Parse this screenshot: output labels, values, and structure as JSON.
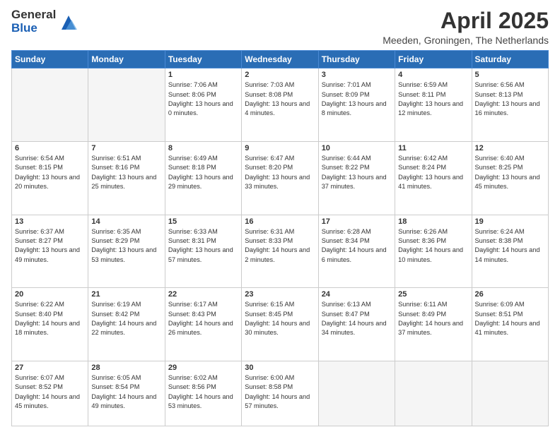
{
  "header": {
    "logo_general": "General",
    "logo_blue": "Blue",
    "month_title": "April 2025",
    "location": "Meeden, Groningen, The Netherlands"
  },
  "days_of_week": [
    "Sunday",
    "Monday",
    "Tuesday",
    "Wednesday",
    "Thursday",
    "Friday",
    "Saturday"
  ],
  "weeks": [
    [
      {
        "day": "",
        "info": ""
      },
      {
        "day": "",
        "info": ""
      },
      {
        "day": "1",
        "info": "Sunrise: 7:06 AM\nSunset: 8:06 PM\nDaylight: 13 hours and 0 minutes."
      },
      {
        "day": "2",
        "info": "Sunrise: 7:03 AM\nSunset: 8:08 PM\nDaylight: 13 hours and 4 minutes."
      },
      {
        "day": "3",
        "info": "Sunrise: 7:01 AM\nSunset: 8:09 PM\nDaylight: 13 hours and 8 minutes."
      },
      {
        "day": "4",
        "info": "Sunrise: 6:59 AM\nSunset: 8:11 PM\nDaylight: 13 hours and 12 minutes."
      },
      {
        "day": "5",
        "info": "Sunrise: 6:56 AM\nSunset: 8:13 PM\nDaylight: 13 hours and 16 minutes."
      }
    ],
    [
      {
        "day": "6",
        "info": "Sunrise: 6:54 AM\nSunset: 8:15 PM\nDaylight: 13 hours and 20 minutes."
      },
      {
        "day": "7",
        "info": "Sunrise: 6:51 AM\nSunset: 8:16 PM\nDaylight: 13 hours and 25 minutes."
      },
      {
        "day": "8",
        "info": "Sunrise: 6:49 AM\nSunset: 8:18 PM\nDaylight: 13 hours and 29 minutes."
      },
      {
        "day": "9",
        "info": "Sunrise: 6:47 AM\nSunset: 8:20 PM\nDaylight: 13 hours and 33 minutes."
      },
      {
        "day": "10",
        "info": "Sunrise: 6:44 AM\nSunset: 8:22 PM\nDaylight: 13 hours and 37 minutes."
      },
      {
        "day": "11",
        "info": "Sunrise: 6:42 AM\nSunset: 8:24 PM\nDaylight: 13 hours and 41 minutes."
      },
      {
        "day": "12",
        "info": "Sunrise: 6:40 AM\nSunset: 8:25 PM\nDaylight: 13 hours and 45 minutes."
      }
    ],
    [
      {
        "day": "13",
        "info": "Sunrise: 6:37 AM\nSunset: 8:27 PM\nDaylight: 13 hours and 49 minutes."
      },
      {
        "day": "14",
        "info": "Sunrise: 6:35 AM\nSunset: 8:29 PM\nDaylight: 13 hours and 53 minutes."
      },
      {
        "day": "15",
        "info": "Sunrise: 6:33 AM\nSunset: 8:31 PM\nDaylight: 13 hours and 57 minutes."
      },
      {
        "day": "16",
        "info": "Sunrise: 6:31 AM\nSunset: 8:33 PM\nDaylight: 14 hours and 2 minutes."
      },
      {
        "day": "17",
        "info": "Sunrise: 6:28 AM\nSunset: 8:34 PM\nDaylight: 14 hours and 6 minutes."
      },
      {
        "day": "18",
        "info": "Sunrise: 6:26 AM\nSunset: 8:36 PM\nDaylight: 14 hours and 10 minutes."
      },
      {
        "day": "19",
        "info": "Sunrise: 6:24 AM\nSunset: 8:38 PM\nDaylight: 14 hours and 14 minutes."
      }
    ],
    [
      {
        "day": "20",
        "info": "Sunrise: 6:22 AM\nSunset: 8:40 PM\nDaylight: 14 hours and 18 minutes."
      },
      {
        "day": "21",
        "info": "Sunrise: 6:19 AM\nSunset: 8:42 PM\nDaylight: 14 hours and 22 minutes."
      },
      {
        "day": "22",
        "info": "Sunrise: 6:17 AM\nSunset: 8:43 PM\nDaylight: 14 hours and 26 minutes."
      },
      {
        "day": "23",
        "info": "Sunrise: 6:15 AM\nSunset: 8:45 PM\nDaylight: 14 hours and 30 minutes."
      },
      {
        "day": "24",
        "info": "Sunrise: 6:13 AM\nSunset: 8:47 PM\nDaylight: 14 hours and 34 minutes."
      },
      {
        "day": "25",
        "info": "Sunrise: 6:11 AM\nSunset: 8:49 PM\nDaylight: 14 hours and 37 minutes."
      },
      {
        "day": "26",
        "info": "Sunrise: 6:09 AM\nSunset: 8:51 PM\nDaylight: 14 hours and 41 minutes."
      }
    ],
    [
      {
        "day": "27",
        "info": "Sunrise: 6:07 AM\nSunset: 8:52 PM\nDaylight: 14 hours and 45 minutes."
      },
      {
        "day": "28",
        "info": "Sunrise: 6:05 AM\nSunset: 8:54 PM\nDaylight: 14 hours and 49 minutes."
      },
      {
        "day": "29",
        "info": "Sunrise: 6:02 AM\nSunset: 8:56 PM\nDaylight: 14 hours and 53 minutes."
      },
      {
        "day": "30",
        "info": "Sunrise: 6:00 AM\nSunset: 8:58 PM\nDaylight: 14 hours and 57 minutes."
      },
      {
        "day": "",
        "info": ""
      },
      {
        "day": "",
        "info": ""
      },
      {
        "day": "",
        "info": ""
      }
    ]
  ]
}
